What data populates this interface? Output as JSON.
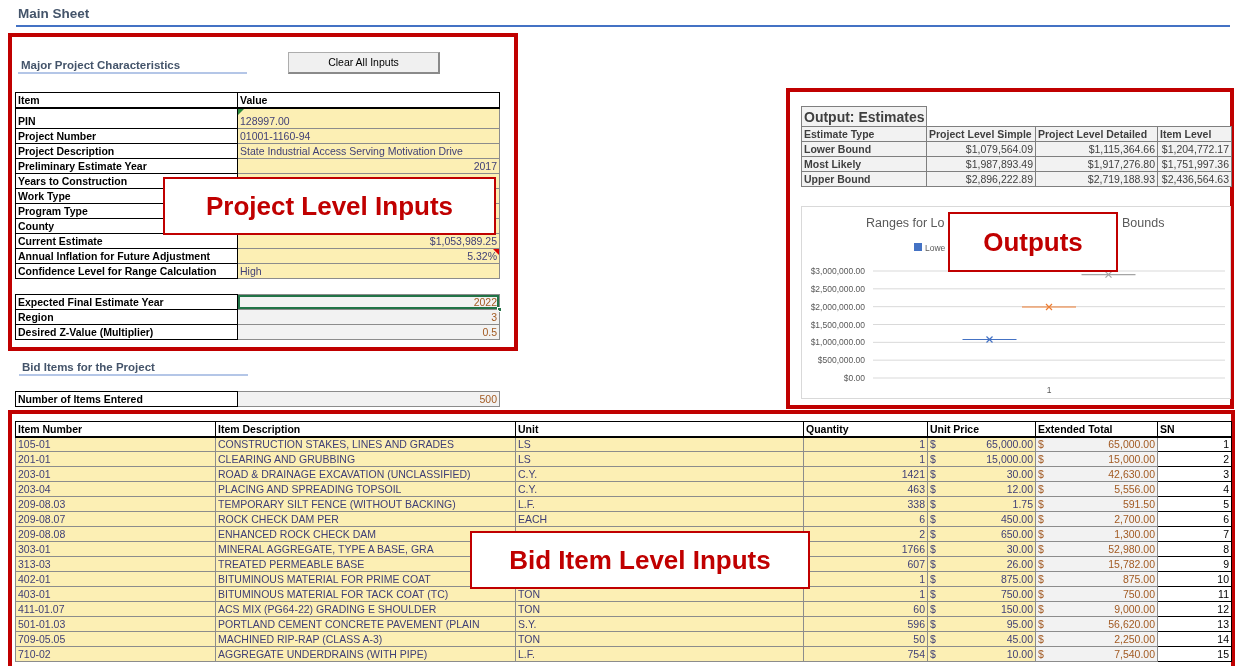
{
  "sheet_title": "Main Sheet",
  "project_section": {
    "heading": "Major Project Characteristics",
    "clear_button": "Clear All Inputs",
    "columns": [
      "Item",
      "Value"
    ],
    "rows": [
      {
        "item": "PIN",
        "value": "128997.00",
        "kind": "text",
        "error_flag": true,
        "comment_flag": false
      },
      {
        "item": "Project Number",
        "value": "01001-1160-94",
        "kind": "text",
        "error_flag": false,
        "comment_flag": false
      },
      {
        "item": "Project Description",
        "value": "State Industrial Access Serving Motivation Drive",
        "kind": "text",
        "error_flag": false,
        "comment_flag": false
      },
      {
        "item": "Preliminary Estimate Year",
        "value": "2017",
        "kind": "number",
        "error_flag": false,
        "comment_flag": false
      },
      {
        "item": "Years to Construction",
        "kind": "number"
      },
      {
        "item": "Work Type",
        "kind": "text"
      },
      {
        "item": "Program Type",
        "kind": "text"
      },
      {
        "item": "County",
        "kind": "text"
      },
      {
        "item": "Current Estimate",
        "value": "$1,053,989.25",
        "kind": "number",
        "error_flag": false,
        "comment_flag": false
      },
      {
        "item": "Annual Inflation for Future Adjustment",
        "value": "5.32%",
        "kind": "number",
        "error_flag": false,
        "comment_flag": true
      },
      {
        "item": "Confidence Level for Range Calculation",
        "value": "High",
        "kind": "text",
        "error_flag": false,
        "comment_flag": false
      }
    ],
    "derived_rows": [
      {
        "item": "Expected Final Estimate Year",
        "value": "2022",
        "selected": true
      },
      {
        "item": "Region",
        "value": "3",
        "selected": false
      },
      {
        "item": "Desired Z-Value (Multiplier)",
        "value": "0.5",
        "selected": false
      }
    ]
  },
  "bid_section": {
    "heading": "Bid Items for the Project",
    "count_label": "Number of Items Entered",
    "count_value": "500"
  },
  "outputs": {
    "table": {
      "title": "Output: Estimates",
      "columns": [
        "Estimate Type",
        "Project Level Simple",
        "Project Level Detailed",
        "Item Level"
      ],
      "rows": [
        [
          "Lower Bound",
          "$1,079,564.09",
          "$1,115,364.66",
          "$1,204,772.17"
        ],
        [
          "Most Likely",
          "$1,987,893.49",
          "$1,917,276.80",
          "$1,751,997.36"
        ],
        [
          "Upper Bound",
          "$2,896,222.89",
          "$2,719,188.93",
          "$2,436,564.63"
        ]
      ]
    },
    "chart": {
      "title_visible": [
        "Ranges for Lo",
        "Bounds"
      ],
      "chart_data": {
        "type": "scatter",
        "grid": true,
        "categories": [
          "1"
        ],
        "series": [
          {
            "name": "Lowe",
            "color": "#4472c4",
            "values": [
              1080000
            ]
          },
          {
            "color": "#ed7d31",
            "values": [
              1990000
            ]
          },
          {
            "color": "#a5a5a5",
            "values": [
              2900000
            ]
          }
        ],
        "ylim": [
          0,
          3000000
        ],
        "yticks": [
          {
            "value": 0,
            "label": "$0.00"
          },
          {
            "value": 500000,
            "label": "$500,000.00"
          },
          {
            "value": 1000000,
            "label": "$1,000,000.00"
          },
          {
            "value": 1500000,
            "label": "$1,500,000.00"
          },
          {
            "value": 2000000,
            "label": "$2,000,000.00"
          },
          {
            "value": 2500000,
            "label": "$2,500,000.00"
          },
          {
            "value": 3000000,
            "label": "$3,000,000.00"
          }
        ]
      }
    }
  },
  "bid_items": {
    "columns": [
      "Item Number",
      "Item Description",
      "Unit",
      "Quantity",
      "Unit Price",
      "Extended Total",
      "SN"
    ],
    "rows": [
      {
        "number": "105-01",
        "description": "CONSTRUCTION STAKES, LINES AND GRADES",
        "unit": "LS",
        "quantity": "1",
        "price_symbol": "$",
        "unit_price": "65,000.00",
        "total_symbol": "$",
        "extended_total": "65,000.00",
        "sn": "1"
      },
      {
        "number": "201-01",
        "description": "CLEARING AND GRUBBING",
        "unit": "LS",
        "quantity": "1",
        "price_symbol": "$",
        "unit_price": "15,000.00",
        "total_symbol": "$",
        "extended_total": "15,000.00",
        "sn": "2"
      },
      {
        "number": "203-01",
        "description": "ROAD & DRAINAGE EXCAVATION (UNCLASSIFIED)",
        "unit": "C.Y.",
        "quantity": "1421",
        "price_symbol": "$",
        "unit_price": "30.00",
        "total_symbol": "$",
        "extended_total": "42,630.00",
        "sn": "3"
      },
      {
        "number": "203-04",
        "description": "PLACING AND SPREADING TOPSOIL",
        "unit": "C.Y.",
        "quantity": "463",
        "price_symbol": "$",
        "unit_price": "12.00",
        "total_symbol": "$",
        "extended_total": "5,556.00",
        "sn": "4"
      },
      {
        "number": "209-08.03",
        "description": "TEMPORARY SILT FENCE (WITHOUT BACKING)",
        "unit": "L.F.",
        "quantity": "338",
        "price_symbol": "$",
        "unit_price": "1.75",
        "total_symbol": "$",
        "extended_total": "591.50",
        "sn": "5"
      },
      {
        "number": "209-08.07",
        "description": "ROCK CHECK DAM PER",
        "unit": "EACH",
        "quantity": "6",
        "price_symbol": "$",
        "unit_price": "450.00",
        "total_symbol": "$",
        "extended_total": "2,700.00",
        "sn": "6"
      },
      {
        "number": "209-08.08",
        "description": "ENHANCED ROCK CHECK DAM",
        "quantity": "2",
        "price_symbol": "$",
        "unit_price": "650.00",
        "total_symbol": "$",
        "extended_total": "1,300.00",
        "sn": "7"
      },
      {
        "number": "303-01",
        "description": "MINERAL AGGREGATE, TYPE A BASE, GRA",
        "quantity": "1766",
        "price_symbol": "$",
        "unit_price": "30.00",
        "total_symbol": "$",
        "extended_total": "52,980.00",
        "sn": "8"
      },
      {
        "number": "313-03",
        "description": "TREATED PERMEABLE BASE",
        "quantity": "607",
        "price_symbol": "$",
        "unit_price": "26.00",
        "total_symbol": "$",
        "extended_total": "15,782.00",
        "sn": "9"
      },
      {
        "number": "402-01",
        "description": "BITUMINOUS MATERIAL FOR PRIME COAT",
        "quantity": "1",
        "price_symbol": "$",
        "unit_price": "875.00",
        "total_symbol": "$",
        "extended_total": "875.00",
        "sn": "10"
      },
      {
        "number": "403-01",
        "description": "BITUMINOUS MATERIAL FOR TACK COAT (TC)",
        "unit": "TON",
        "quantity": "1",
        "price_symbol": "$",
        "unit_price": "750.00",
        "total_symbol": "$",
        "extended_total": "750.00",
        "sn": "11"
      },
      {
        "number": "411-01.07",
        "description": "ACS MIX (PG64-22) GRADING E SHOULDER",
        "unit": "TON",
        "quantity": "60",
        "price_symbol": "$",
        "unit_price": "150.00",
        "total_symbol": "$",
        "extended_total": "9,000.00",
        "sn": "12"
      },
      {
        "number": "501-01.03",
        "description": "PORTLAND CEMENT CONCRETE PAVEMENT (PLAIN",
        "unit": "S.Y.",
        "quantity": "596",
        "price_symbol": "$",
        "unit_price": "95.00",
        "total_symbol": "$",
        "extended_total": "56,620.00",
        "sn": "13"
      },
      {
        "number": "709-05.05",
        "description": "MACHINED RIP-RAP (CLASS A-3)",
        "unit": "TON",
        "quantity": "50",
        "price_symbol": "$",
        "unit_price": "45.00",
        "total_symbol": "$",
        "extended_total": "2,250.00",
        "sn": "14"
      },
      {
        "number": "710-02",
        "description": "AGGREGATE UNDERDRAINS (WITH PIPE)",
        "unit": "L.F.",
        "quantity": "754",
        "price_symbol": "$",
        "unit_price": "10.00",
        "total_symbol": "$",
        "extended_total": "7,540.00",
        "sn": "15"
      }
    ]
  },
  "callouts": [
    {
      "text": "Project Level Inputs"
    },
    {
      "text": "Outputs"
    },
    {
      "text": "Bid Item Level Inputs"
    }
  ]
}
